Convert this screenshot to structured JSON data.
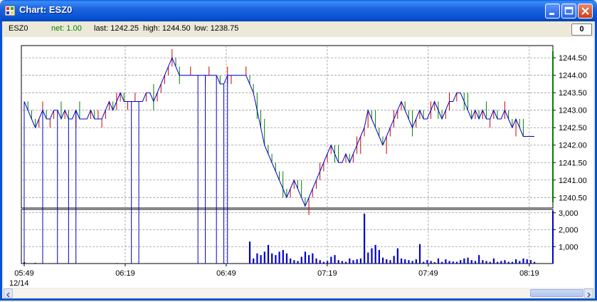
{
  "window": {
    "title": "Chart: ESZ0",
    "minimize_icon": "minimize-icon",
    "maximize_icon": "maximize-icon",
    "close_icon": "close-icon"
  },
  "info": {
    "symbol": "ESZ0",
    "net": "net: 1.00",
    "last": "last: 1242.25",
    "high": "high: 1244.50",
    "low": "low: 1238.75",
    "net_color": "#008000"
  },
  "zero_button": {
    "label": "0"
  },
  "colors": {
    "up": "#cc0000",
    "down": "#008000",
    "line": "#0000cc",
    "volume": "#0000cc"
  },
  "chart_data": [
    {
      "type": "line",
      "y_ticks": [
        "1244.50",
        "1244.00",
        "1243.50",
        "1243.00",
        "1242.50",
        "1242.00",
        "1241.50",
        "1241.00",
        "1240.50"
      ],
      "x_ticks": [
        "05:49",
        "06:19",
        "06:49",
        "07:19",
        "07:49",
        "08:19"
      ],
      "x_sublabel": "12/14",
      "grid": true,
      "ylim": [
        1240.2,
        1244.85
      ],
      "price": [
        1243.25,
        1243.0,
        1242.75,
        1242.5,
        1242.75,
        1243.0,
        1242.75,
        1242.75,
        1243.0,
        1243.0,
        1242.75,
        1243.0,
        1242.75,
        1242.75,
        1243.0,
        1242.75,
        1242.75,
        1242.75,
        1243.0,
        1242.75,
        1242.75,
        1242.75,
        1243.0,
        1243.25,
        1243.0,
        1243.25,
        1243.5,
        1243.25,
        1243.25,
        1243.25,
        1243.25,
        1243.25,
        1243.25,
        1243.5,
        1243.5,
        1243.25,
        1243.5,
        1243.75,
        1244.0,
        1244.25,
        1244.5,
        1244.25,
        1244.0,
        1244.0,
        1244.0,
        1244.0,
        1244.0,
        1244.0,
        1244.0,
        1244.0,
        1244.0,
        1244.0,
        1244.0,
        1243.75,
        1243.75,
        1244.0,
        1244.0,
        1244.0,
        1244.0,
        1244.0,
        1244.0,
        1243.75,
        1243.5,
        1243.0,
        1242.5,
        1242.0,
        1241.75,
        1241.5,
        1241.25,
        1241.0,
        1240.75,
        1240.5,
        1240.75,
        1241.0,
        1240.75,
        1240.5,
        1240.25,
        1240.5,
        1240.75,
        1241.0,
        1241.25,
        1241.5,
        1241.75,
        1242.0,
        1241.75,
        1241.5,
        1241.5,
        1241.75,
        1241.5,
        1241.75,
        1242.0,
        1242.25,
        1242.5,
        1243.0,
        1242.75,
        1242.5,
        1242.25,
        1242.0,
        1242.25,
        1242.5,
        1242.75,
        1243.0,
        1243.25,
        1243.0,
        1242.75,
        1242.5,
        1242.75,
        1243.0,
        1242.75,
        1242.75,
        1243.0,
        1243.25,
        1243.0,
        1242.75,
        1243.0,
        1243.25,
        1243.25,
        1243.5,
        1243.5,
        1243.25,
        1243.0,
        1242.75,
        1243.0,
        1242.75,
        1243.0,
        1242.75,
        1242.75,
        1243.0,
        1242.75,
        1242.75,
        1243.0,
        1242.75,
        1242.5,
        1242.75,
        1242.5,
        1242.25,
        1242.25,
        1242.25,
        1242.25
      ]
    },
    {
      "type": "bar",
      "y_ticks": [
        "3,000",
        "2,000",
        "1,000"
      ],
      "ylim": [
        0,
        3200
      ],
      "volume": [
        80,
        0,
        0,
        40,
        0,
        0,
        20,
        0,
        0,
        0,
        0,
        0,
        0,
        0,
        0,
        0,
        0,
        0,
        0,
        0,
        0,
        0,
        0,
        0,
        0,
        30,
        0,
        0,
        0,
        0,
        0,
        0,
        0,
        0,
        0,
        0,
        0,
        0,
        0,
        0,
        0,
        0,
        0,
        0,
        0,
        0,
        0,
        0,
        0,
        0,
        0,
        0,
        0,
        0,
        40,
        0,
        0,
        0,
        0,
        0,
        0,
        1300,
        300,
        600,
        500,
        700,
        1100,
        600,
        500,
        700,
        800,
        600,
        300,
        200,
        150,
        400,
        700,
        500,
        600,
        300,
        200,
        100,
        150,
        400,
        500,
        200,
        150,
        100,
        300,
        200,
        250,
        300,
        2950,
        650,
        900,
        1100,
        800,
        350,
        250,
        200,
        450,
        900,
        300,
        250,
        200,
        150,
        250,
        1150,
        100,
        200,
        150,
        80,
        300,
        100,
        250,
        150,
        120,
        100,
        200,
        300,
        350,
        200,
        150,
        500,
        200,
        150,
        100,
        300,
        100,
        150,
        200,
        100,
        100,
        250,
        150,
        300,
        250,
        200,
        100
      ]
    }
  ]
}
